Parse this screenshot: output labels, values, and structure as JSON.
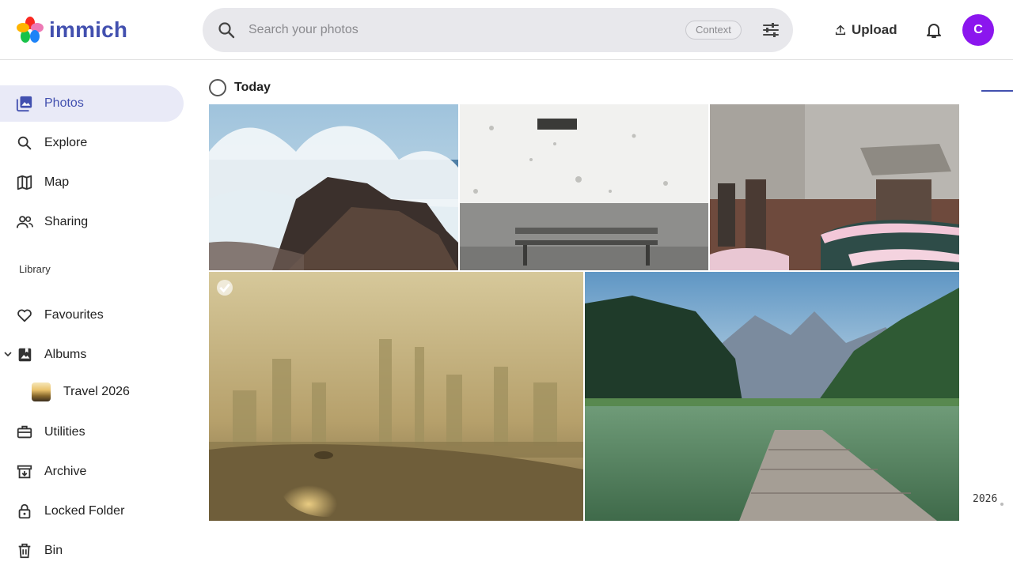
{
  "app": {
    "name": "immich",
    "brand_color": "#4250af"
  },
  "search": {
    "placeholder": "Search your photos",
    "value": "",
    "context_label": "Context"
  },
  "header": {
    "upload_label": "Upload",
    "avatar_initial": "C",
    "avatar_color": "#8b16ee"
  },
  "sidebar": {
    "primary": [
      {
        "label": "Photos",
        "icon": "photos-icon",
        "active": true
      },
      {
        "label": "Explore",
        "icon": "search-icon"
      },
      {
        "label": "Map",
        "icon": "map-icon"
      },
      {
        "label": "Sharing",
        "icon": "people-icon"
      }
    ],
    "library_label": "Library",
    "library": [
      {
        "label": "Favourites",
        "icon": "heart-icon"
      },
      {
        "label": "Albums",
        "icon": "album-icon"
      }
    ],
    "album_child": {
      "label": "Travel 2026"
    },
    "more": [
      {
        "label": "Utilities",
        "icon": "toolbox-icon"
      },
      {
        "label": "Archive",
        "icon": "archive-icon"
      },
      {
        "label": "Locked Folder",
        "icon": "lock-icon"
      },
      {
        "label": "Bin",
        "icon": "trash-icon"
      }
    ]
  },
  "timeline": {
    "group_label": "Today",
    "photos": [
      {
        "subject": "waves-on-rocks"
      },
      {
        "subject": "bench-by-wall"
      },
      {
        "subject": "old-building-cars"
      },
      {
        "subject": "hazy-city-skyline"
      },
      {
        "subject": "lake-pier-mountains"
      }
    ],
    "scrubber_year": "2026"
  }
}
